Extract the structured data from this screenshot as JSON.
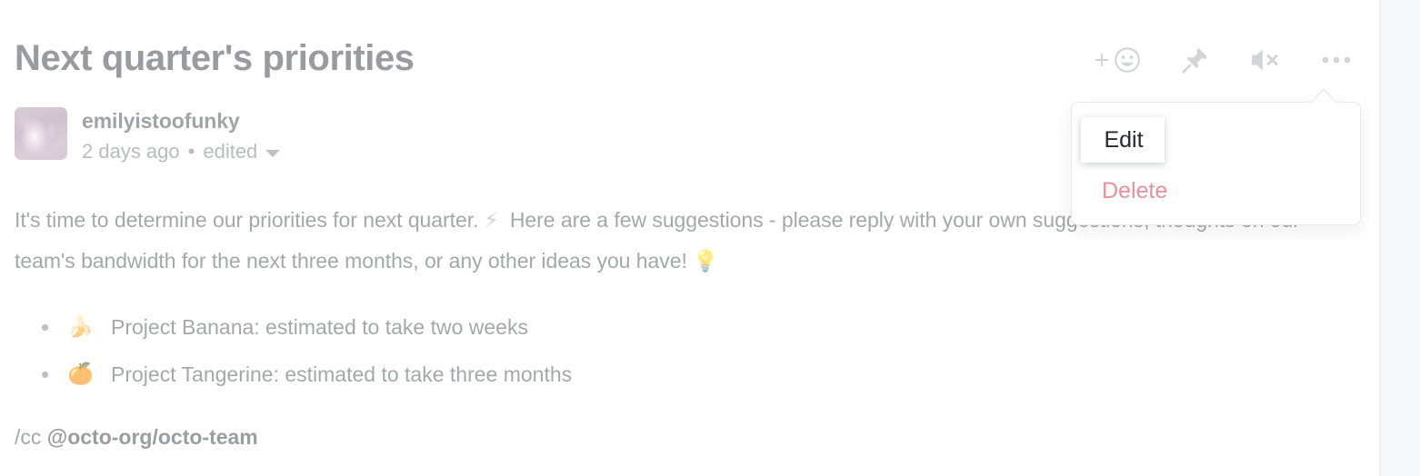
{
  "issue": {
    "title": "Next quarter's priorities"
  },
  "actions": [
    {
      "name": "add-reaction-button",
      "icon": "add-reaction-icon",
      "label": ""
    },
    {
      "name": "pin-issue-button",
      "icon": "pin-icon",
      "label": ""
    },
    {
      "name": "unsubscribe-button",
      "icon": "mute-icon",
      "label": ""
    },
    {
      "name": "more-options-button",
      "icon": "kebab-menu-icon",
      "label": ""
    }
  ],
  "comment": {
    "author": "emilyistoofunky",
    "timestamp": "2 days ago",
    "separator": "•",
    "edited_label": "edited",
    "body": {
      "line1_a": "It's time to determine our priorities for next quarter.",
      "emoji_zap": "⚡",
      "line1_b": "Here are a few suggestions - please reply with your own suggestions, thoughts on our team's bandwidth for the next three months, or any other ideas you have!",
      "emoji_bulb": "💡"
    },
    "bullets": [
      {
        "emoji": "🍌",
        "text": "Project Banana: estimated to take two weeks"
      },
      {
        "emoji": "🍊",
        "text": "Project Tangerine: estimated to take three months"
      }
    ],
    "cc_prefix": "/cc ",
    "cc_mention": "@octo-org/octo-team"
  },
  "dropdown": {
    "edit_label": "Edit",
    "delete_label": "Delete"
  },
  "colors": {
    "title": "#9a9ba0",
    "body_text": "#a5a7ac",
    "delete": "#e8919b",
    "edit": "#24292f",
    "icon": "#d2d4d8",
    "rail": "#f7f8fa"
  }
}
